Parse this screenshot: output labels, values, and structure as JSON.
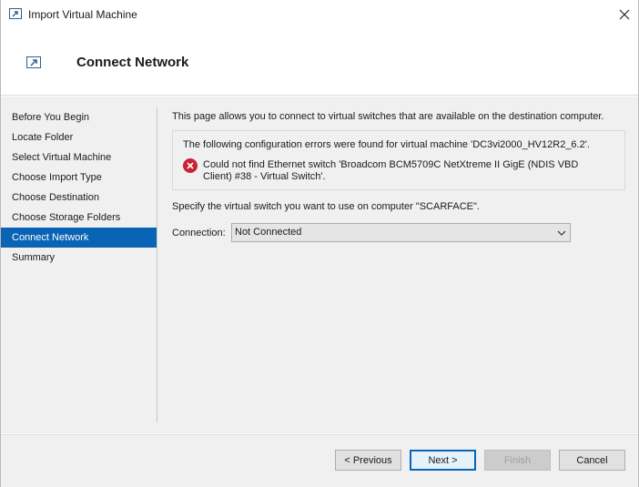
{
  "window": {
    "title": "Import Virtual Machine"
  },
  "header": {
    "title": "Connect Network"
  },
  "nav": {
    "items": [
      {
        "label": "Before You Begin"
      },
      {
        "label": "Locate Folder"
      },
      {
        "label": "Select Virtual Machine"
      },
      {
        "label": "Choose Import Type"
      },
      {
        "label": "Choose Destination"
      },
      {
        "label": "Choose Storage Folders"
      },
      {
        "label": "Connect Network",
        "active": true
      },
      {
        "label": "Summary"
      }
    ]
  },
  "main": {
    "intro": "This page allows you to connect to virtual switches that are available on the destination computer.",
    "error_header": "The following configuration errors were found for virtual machine 'DC3vi2000_HV12R2_6.2'.",
    "error_message": "Could not find Ethernet switch 'Broadcom BCM5709C NetXtreme II GigE (NDIS VBD Client) #38 - Virtual Switch'.",
    "specify": "Specify the virtual switch you want to use on computer \"SCARFACE\".",
    "connection_label": "Connection:",
    "connection_value": "Not Connected"
  },
  "footer": {
    "previous": "< Previous",
    "next": "Next >",
    "finish": "Finish",
    "cancel": "Cancel"
  },
  "colors": {
    "accent": "#0a64b5",
    "error": "#c92434"
  }
}
